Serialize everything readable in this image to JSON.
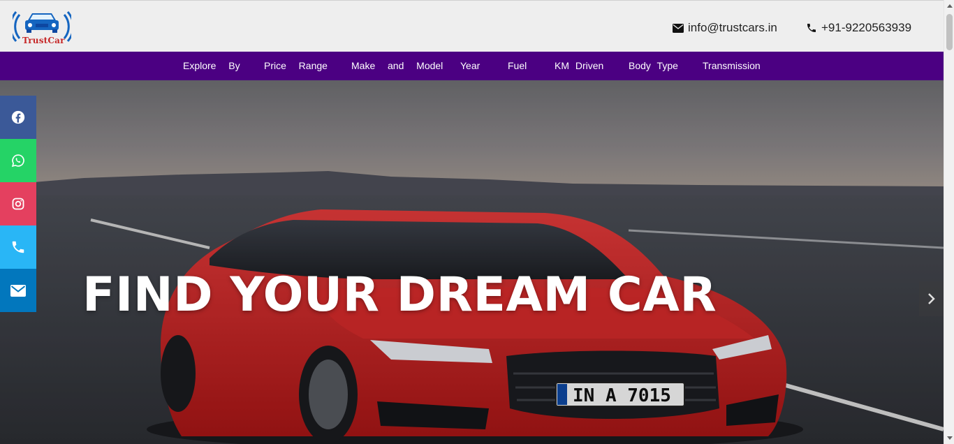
{
  "brand": {
    "logo_text": "TrustCar",
    "logo_color": "#c62828",
    "accent_blue": "#1565c0"
  },
  "header": {
    "email": "info@trustcars.in",
    "phone": "+91-9220563939",
    "email_icon": "envelope-icon",
    "phone_icon": "phone-icon"
  },
  "nav": {
    "background": "#4b0082",
    "items": [
      {
        "label": "Explore  By"
      },
      {
        "label": "Price  Range"
      },
      {
        "label": "Make  and  Model"
      },
      {
        "label": "Year"
      },
      {
        "label": "Fuel"
      },
      {
        "label": "KM Driven"
      },
      {
        "label": "Body Type"
      },
      {
        "label": "Transmission"
      }
    ]
  },
  "hero": {
    "title": "FIND YOUR DREAM CAR",
    "plate": "IN A 7015",
    "next_icon": "chevron-right-icon"
  },
  "social": [
    {
      "name": "facebook",
      "icon": "facebook-icon",
      "color": "#3b5998"
    },
    {
      "name": "whatsapp",
      "icon": "whatsapp-icon",
      "color": "#25d366"
    },
    {
      "name": "instagram",
      "icon": "instagram-icon",
      "color": "#e4405f"
    },
    {
      "name": "phone",
      "icon": "phone-icon",
      "color": "#29b6f6"
    },
    {
      "name": "email",
      "icon": "envelope-icon",
      "color": "#0277bd"
    }
  ]
}
